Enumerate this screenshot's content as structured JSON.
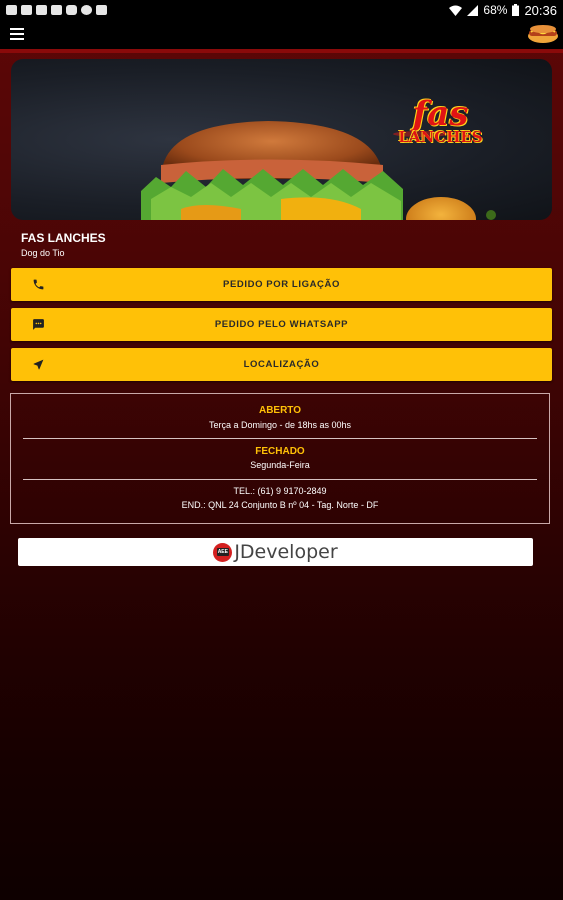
{
  "status_bar": {
    "battery": "68%",
    "time": "20:36",
    "notification_icons": [
      "youtube-icon",
      "youtube-icon",
      "youtube-icon",
      "youtube-icon",
      "instagram-icon",
      "reddit-icon",
      "gallery-icon"
    ]
  },
  "app_bar": {
    "menu_icon": "menu-icon",
    "app_icon": "hotdog-icon"
  },
  "banner": {
    "logo_line1": "fas",
    "logo_line2": "LANCHES"
  },
  "store": {
    "name": "FAS LANCHES",
    "subtitle": "Dog do Tio"
  },
  "actions": [
    {
      "label": "PEDIDO POR LIGAÇÃO",
      "icon": "phone-icon"
    },
    {
      "label": "PEDIDO PELO WHATSAPP",
      "icon": "message-icon"
    },
    {
      "label": "LOCALIZAÇÃO",
      "icon": "navigation-icon"
    }
  ],
  "hours": {
    "open_title": "ABERTO",
    "open_text": "Terça a Domingo - de 18hs as 00hs",
    "closed_title": "FECHADO",
    "closed_text": "Segunda-Feira",
    "phone": "TEL.: (61) 9 9170-2849",
    "address": "END.: QNL 24 Conjunto B nº 04 - Tag. Norte - DF"
  },
  "developer": {
    "label": "JDeveloper",
    "badge": "AEE"
  },
  "colors": {
    "accent": "#ffc107",
    "background_top": "#5e0707",
    "background_bottom": "#0e0000"
  }
}
